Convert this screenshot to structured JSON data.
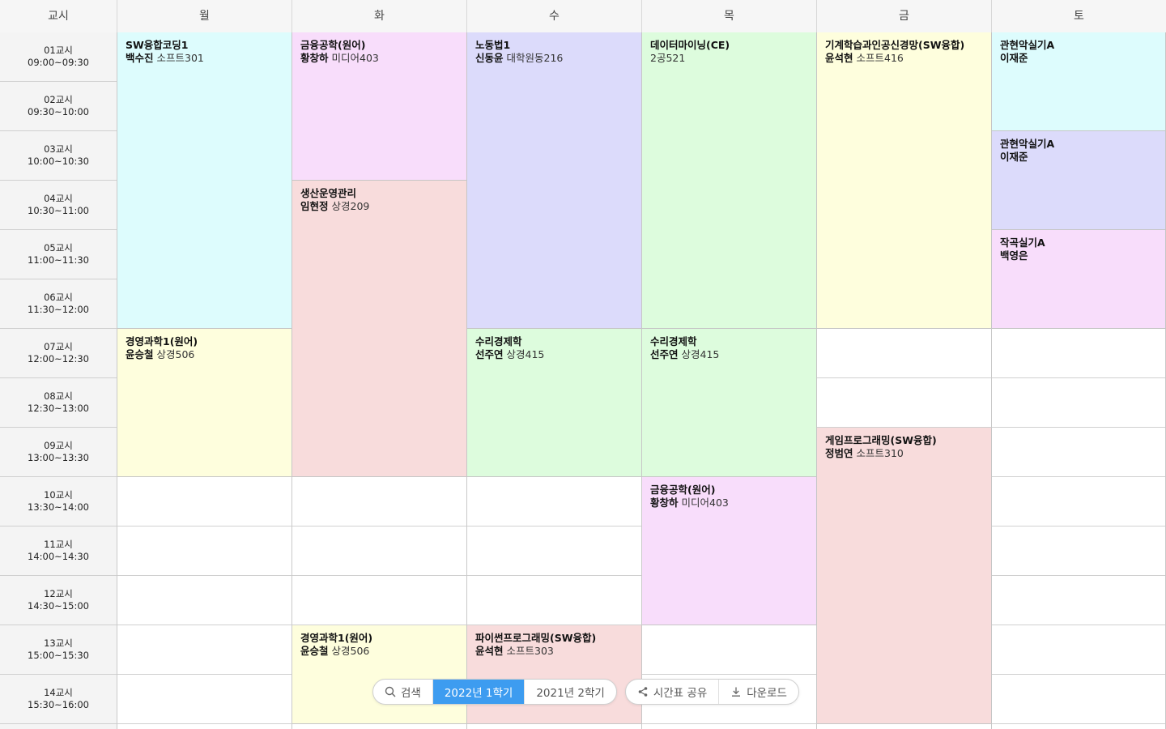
{
  "header": {
    "period_label": "교시",
    "days": [
      "월",
      "화",
      "수",
      "목",
      "금",
      "토"
    ]
  },
  "periods": [
    {
      "name": "01교시",
      "time": "09:00~09:30"
    },
    {
      "name": "02교시",
      "time": "09:30~10:00"
    },
    {
      "name": "03교시",
      "time": "10:00~10:30"
    },
    {
      "name": "04교시",
      "time": "10:30~11:00"
    },
    {
      "name": "05교시",
      "time": "11:00~11:30"
    },
    {
      "name": "06교시",
      "time": "11:30~12:00"
    },
    {
      "name": "07교시",
      "time": "12:00~12:30"
    },
    {
      "name": "08교시",
      "time": "12:30~13:00"
    },
    {
      "name": "09교시",
      "time": "13:00~13:30"
    },
    {
      "name": "10교시",
      "time": "13:30~14:00"
    },
    {
      "name": "11교시",
      "time": "14:00~14:30"
    },
    {
      "name": "12교시",
      "time": "14:30~15:00"
    },
    {
      "name": "13교시",
      "time": "15:00~15:30"
    },
    {
      "name": "14교시",
      "time": "15:30~16:00"
    }
  ],
  "courses": [
    {
      "day": 0,
      "start": 0,
      "span": 6,
      "title": "SW융합코딩1",
      "prof": "백수진",
      "room": "소프트301",
      "color": "#ddfcfd"
    },
    {
      "day": 0,
      "start": 6,
      "span": 3,
      "title": "경영과학1(원어)",
      "prof": "윤승철",
      "room": "상경506",
      "color": "#fefedd"
    },
    {
      "day": 1,
      "start": 0,
      "span": 3,
      "title": "금융공학(원어)",
      "prof": "황창하",
      "room": "미디어403",
      "color": "#f8ddfb"
    },
    {
      "day": 1,
      "start": 3,
      "span": 6,
      "title": "생산운영관리",
      "prof": "임현정",
      "room": "상경209",
      "color": "#f8dcdc"
    },
    {
      "day": 1,
      "start": 12,
      "span": 2,
      "title": "경영과학1(원어)",
      "prof": "윤승철",
      "room": "상경506",
      "color": "#fefedd"
    },
    {
      "day": 2,
      "start": 0,
      "span": 6,
      "title": "노동법1",
      "prof": "신동윤",
      "room": "대학원동216",
      "color": "#dcdbfb"
    },
    {
      "day": 2,
      "start": 6,
      "span": 3,
      "title": "수리경제학",
      "prof": "선주연",
      "room": "상경415",
      "color": "#ddfcdd"
    },
    {
      "day": 2,
      "start": 12,
      "span": 2,
      "title": "파이썬프로그래밍(SW융합)",
      "prof": "윤석현",
      "room": "소프트303",
      "color": "#f8dcdc"
    },
    {
      "day": 3,
      "start": 0,
      "span": 6,
      "title": "데이터마이닝(CE)",
      "prof": "",
      "room": "2공521",
      "color": "#ddfcdd"
    },
    {
      "day": 3,
      "start": 6,
      "span": 3,
      "title": "수리경제학",
      "prof": "선주연",
      "room": "상경415",
      "color": "#ddfcdd"
    },
    {
      "day": 3,
      "start": 9,
      "span": 3,
      "title": "금융공학(원어)",
      "prof": "황창하",
      "room": "미디어403",
      "color": "#f8ddfb"
    },
    {
      "day": 4,
      "start": 0,
      "span": 6,
      "title": "기계학습과인공신경망(SW융합)",
      "prof": "윤석현",
      "room": "소프트416",
      "color": "#fefedd"
    },
    {
      "day": 4,
      "start": 8,
      "span": 6,
      "title": "게임프로그래밍(SW융합)",
      "prof": "정범연",
      "room": "소프트310",
      "color": "#f8dcdc"
    },
    {
      "day": 5,
      "start": 0,
      "span": 2,
      "title": "관현악실기A",
      "prof": "이재준",
      "room": "",
      "color": "#ddfcfd"
    },
    {
      "day": 5,
      "start": 2,
      "span": 2,
      "title": "관현악실기A",
      "prof": "이재준",
      "room": "",
      "color": "#dcdbfb"
    },
    {
      "day": 5,
      "start": 4,
      "span": 2,
      "title": "작곡실기A",
      "prof": "백영은",
      "room": "",
      "color": "#f8ddfb"
    }
  ],
  "toolbar": {
    "search_label": "검색",
    "semester_current": "2022년 1학기",
    "semester_prev": "2021년 2학기",
    "share_label": "시간표 공유",
    "download_label": "다운로드",
    "accent": "#3d9cf0"
  },
  "icons": {
    "search": "search-icon",
    "share": "share-icon",
    "download": "download-icon"
  }
}
